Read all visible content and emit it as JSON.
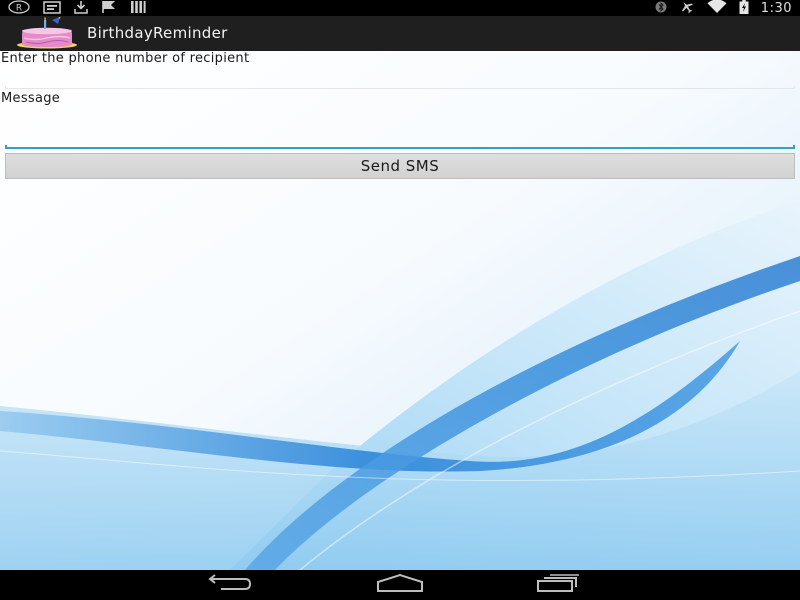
{
  "status_bar": {
    "time": "1:30",
    "left_icons": [
      "registered-icon",
      "message-icon",
      "download-icon",
      "flag-icon",
      "signal-bars-icon"
    ],
    "right_icons": [
      "bluetooth-icon",
      "airplane-icon",
      "wifi-icon",
      "battery-charging-icon"
    ]
  },
  "action_bar": {
    "app_icon": "birthday-cake-icon",
    "title": "BirthdayReminder"
  },
  "form": {
    "phone_label": "Enter the phone number of recipient",
    "phone_value": "",
    "message_label": "Message",
    "message_value": "",
    "send_button_label": "Send SMS"
  },
  "nav_bar": {
    "icons": [
      "back-icon",
      "home-icon",
      "recents-icon"
    ]
  },
  "colors": {
    "status_bar": "#000000",
    "action_bar": "#1f1f1f",
    "focus_accent": "#33a0c8",
    "button": "#d6d6d6",
    "wallpaper_blue": "#3a8fdc"
  }
}
